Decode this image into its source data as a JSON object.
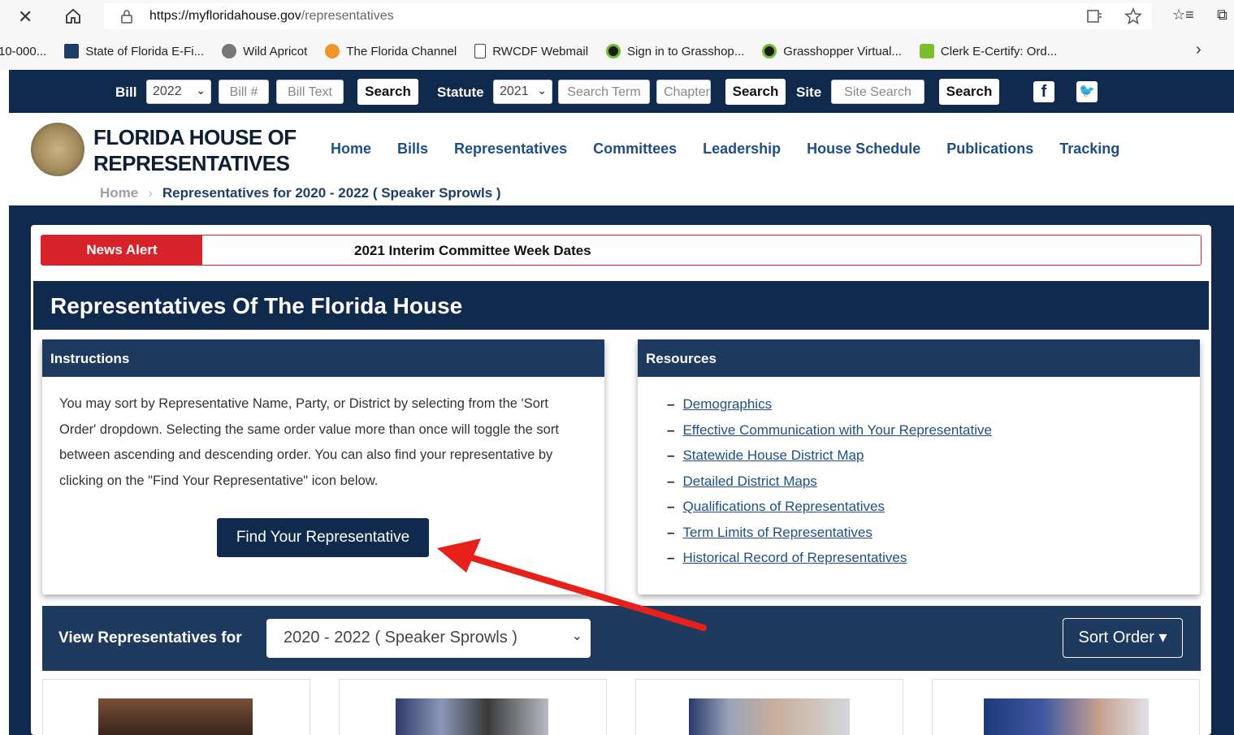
{
  "browser": {
    "url_host": "https://myfloridahouse.gov",
    "url_path": "/representatives",
    "bookmarks": [
      {
        "label": "10-000..."
      },
      {
        "label": "State of Florida E-Fi..."
      },
      {
        "label": "Wild Apricot"
      },
      {
        "label": "The Florida Channel"
      },
      {
        "label": "RWCDF Webmail"
      },
      {
        "label": "Sign in to Grasshop..."
      },
      {
        "label": "Grasshopper Virtual..."
      },
      {
        "label": "Clerk E-Certify: Ord..."
      }
    ]
  },
  "topbar": {
    "bill_label": "Bill",
    "bill_year": "2022",
    "bill_number_placeholder": "Bill #",
    "bill_text_placeholder": "Bill Text",
    "search_label": "Search",
    "statute_label": "Statute",
    "statute_year": "2021",
    "search_term_placeholder": "Search Term",
    "chapter_placeholder": "Chapter",
    "site_label": "Site",
    "site_search_placeholder": "Site Search"
  },
  "header": {
    "brand_line1": "FLORIDA HOUSE OF",
    "brand_line2": "REPRESENTATIVES",
    "nav": [
      "Home",
      "Bills",
      "Representatives",
      "Committees",
      "Leadership",
      "House Schedule",
      "Publications",
      "Tracking"
    ],
    "breadcrumb_home": "Home",
    "breadcrumb_current": "Representatives for 2020 - 2022 ( Speaker Sprowls )"
  },
  "alert": {
    "tag": "News Alert",
    "message": "2021 Interim Committee Week Dates"
  },
  "page_title": "Representatives Of The Florida House",
  "instructions": {
    "heading": "Instructions",
    "text": "You may sort by Representative Name, Party, or District by selecting from the 'Sort Order' dropdown. Selecting the same order value more than once will toggle the sort between ascending and descending order. You can also find your representative by clicking on the \"Find Your Representative\" icon below.",
    "button": "Find Your Representative"
  },
  "resources": {
    "heading": "Resources",
    "links": [
      "Demographics",
      "Effective Communication with Your Representative",
      "Statewide House District Map",
      "Detailed District Maps",
      "Qualifications of Representatives",
      "Term Limits of Representatives",
      "Historical Record of Representatives"
    ]
  },
  "view": {
    "label": "View Representatives for",
    "selected": "2020 - 2022 ( Speaker Sprowls )",
    "sort_button": "Sort Order"
  },
  "colors": {
    "navy": "#0f2a4d",
    "panel_header": "#1e3a5f",
    "link_blue": "#1f4f86",
    "alert_red": "#d8222a",
    "arrow_red": "#e8201c"
  }
}
